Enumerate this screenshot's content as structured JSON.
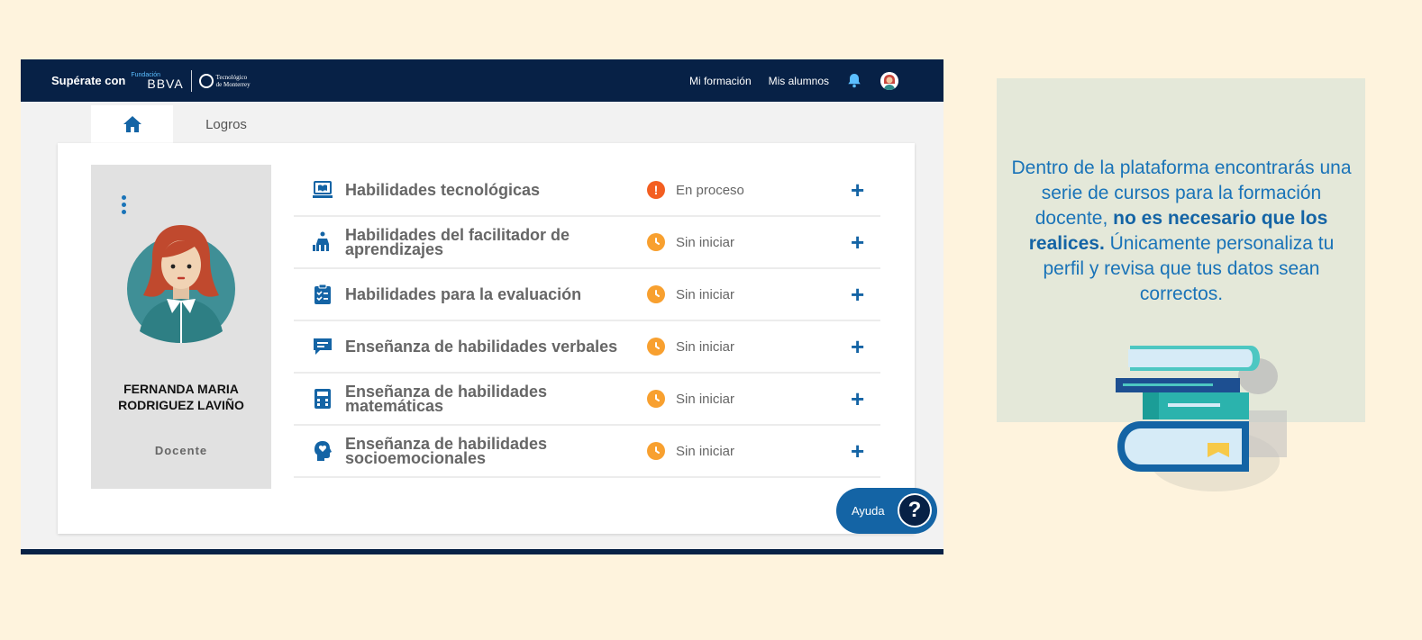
{
  "header": {
    "brand_prefix": "Supérate con",
    "brand_fundacion": "Fundación",
    "brand_bbva": "BBVA",
    "brand_tec_line1": "Tecnológico",
    "brand_tec_line2": "de Monterrey",
    "nav": [
      "Mi formación",
      "Mis alumnos"
    ]
  },
  "tabs": {
    "logros": "Logros"
  },
  "profile": {
    "name": "FERNANDA MARIA RODRIGUEZ LAVIÑO",
    "role": "Docente"
  },
  "courses": [
    {
      "title": "Habilidades tecnológicas",
      "status": "En proceso",
      "status_color": "#f35e21",
      "icon": "laptop-book-icon"
    },
    {
      "title": "Habilidades del facilitador de aprendizajes",
      "status": "Sin iniciar",
      "status_color": "#f8a02f",
      "icon": "teacher-board-icon"
    },
    {
      "title": "Habilidades para la evaluación",
      "status": "Sin iniciar",
      "status_color": "#f8a02f",
      "icon": "clipboard-checklist-icon"
    },
    {
      "title": "Enseñanza de habilidades verbales",
      "status": "Sin iniciar",
      "status_color": "#f8a02f",
      "icon": "speech-bubble-icon"
    },
    {
      "title": "Enseñanza de habilidades matemáticas",
      "status": "Sin iniciar",
      "status_color": "#f8a02f",
      "icon": "calculator-icon"
    },
    {
      "title": "Enseñanza de habilidades socioemocionales",
      "status": "Sin iniciar",
      "status_color": "#f8a02f",
      "icon": "head-heart-icon"
    }
  ],
  "help": {
    "label": "Ayuda",
    "symbol": "?"
  },
  "note": {
    "text_1": "Dentro de la plataforma encontrarás una serie de cursos para la formación docente,",
    "text_bold": "no es necesario que los realices.",
    "text_2": "Únicamente personaliza tu perfil y revisa que tus datos sean correctos."
  },
  "colors": {
    "navy": "#072146",
    "blue": "#1464a5",
    "accent": "#1973b8",
    "background": "#fef3dd"
  }
}
